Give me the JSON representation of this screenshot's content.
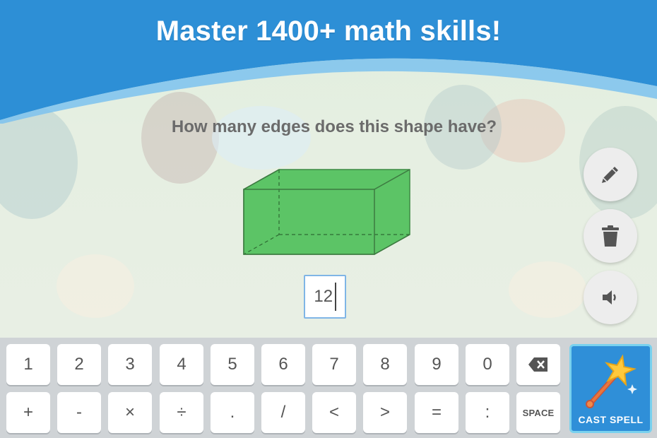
{
  "banner": {
    "title": "Master 1400+ math skills!"
  },
  "question": {
    "text": "How many edges does this shape have?"
  },
  "answer": {
    "value": "12"
  },
  "side_tools": [
    {
      "name": "pencil-button",
      "icon": "pencil-icon"
    },
    {
      "name": "trash-button",
      "icon": "trash-icon"
    },
    {
      "name": "speaker-button",
      "icon": "speaker-icon"
    }
  ],
  "keyboard": {
    "row1": [
      "1",
      "2",
      "3",
      "4",
      "5",
      "6",
      "7",
      "8",
      "9",
      "0"
    ],
    "backspace_icon": "backspace-icon",
    "row2": [
      "+",
      "-",
      "×",
      "÷",
      ".",
      "/",
      "<",
      ">",
      "=",
      ":"
    ],
    "space_label": "SPACE"
  },
  "cast_spell": {
    "label": "CAST SPELL",
    "icon": "magic-wand-icon"
  },
  "colors": {
    "banner_blue": "#2d8fd6",
    "shape_green": "#5cc466",
    "cast_blue": "#2f8fd8"
  }
}
